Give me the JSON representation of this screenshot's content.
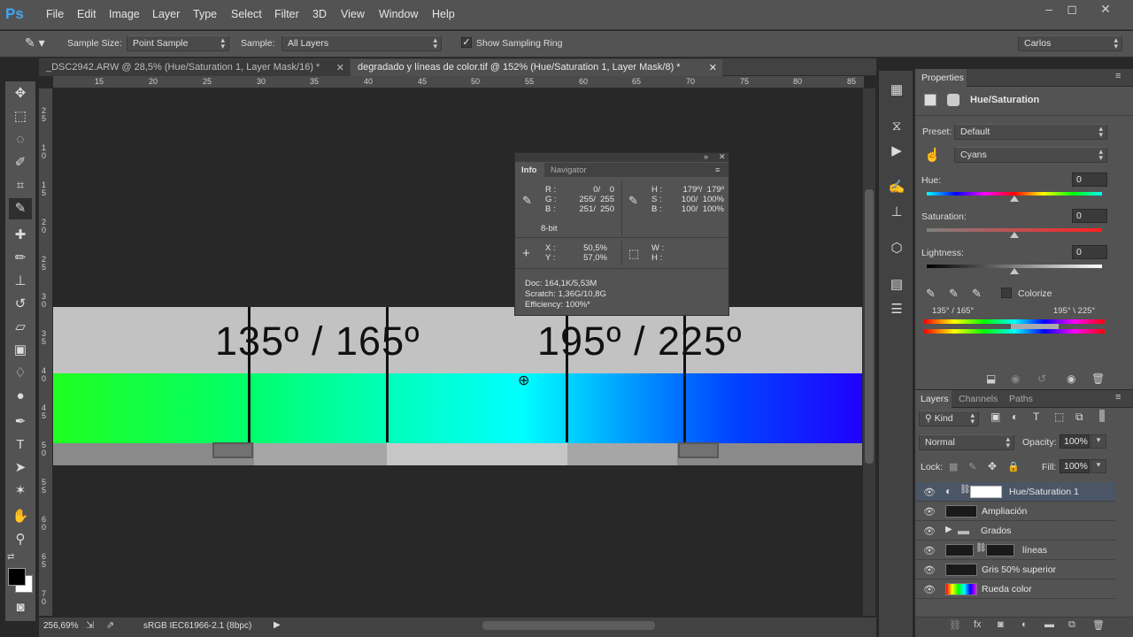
{
  "app": {
    "logo": "Ps"
  },
  "menu": [
    "File",
    "Edit",
    "Image",
    "Layer",
    "Type",
    "Select",
    "Filter",
    "3D",
    "View",
    "Window",
    "Help"
  ],
  "window_controls": {
    "minimize": "–",
    "maximize": "◻",
    "close": "✕"
  },
  "options_bar": {
    "sample_size_label": "Sample Size:",
    "sample_size_value": "Point Sample",
    "sample_label": "Sample:",
    "sample_value": "All Layers",
    "show_ring_label": "Show Sampling Ring",
    "show_ring_checked": true,
    "workspace": "Carlos"
  },
  "tabs": [
    {
      "title": "_DSC2942.ARW @ 28,5% (Hue/Saturation 1, Layer Mask/16) *",
      "close": "✕",
      "active": false
    },
    {
      "title": "degradado y líneas de color.tif @ 152% (Hue/Saturation 1, Layer Mask/8) *",
      "close": "✕",
      "active": true
    }
  ],
  "ruler_top": [
    "15",
    "20",
    "25",
    "30",
    "35",
    "40",
    "45",
    "50",
    "55",
    "60",
    "65",
    "70",
    "75",
    "80",
    "85"
  ],
  "ruler_left": [
    "2",
    "5",
    "1",
    "0",
    "1",
    "5",
    "2",
    "0",
    "2",
    "5",
    "3",
    "0",
    "3",
    "5",
    "4",
    "0",
    "4",
    "5",
    "5",
    "0",
    "5",
    "5",
    "6",
    "0",
    "6",
    "5",
    "7",
    "0"
  ],
  "canvas": {
    "labels": [
      "135º / 165º",
      "195º / 225º"
    ]
  },
  "info_panel": {
    "tabs": [
      "Info",
      "Navigator"
    ],
    "rgb": {
      "R": "0/    0",
      "G": "255/  255",
      "B": "251/  250"
    },
    "hsb": {
      "H": "179º/  179º",
      "S": "100/  100%",
      "B": "100/  100%"
    },
    "bit_depth": "8-bit",
    "xy": {
      "X": "50,5%",
      "Y": "57,0%"
    },
    "wh": {
      "W": "",
      "H": ""
    },
    "doc": "Doc: 164,1K/5,53M",
    "scratch": "Scratch: 1,36G/10,8G",
    "efficiency": "Efficiency: 100%*"
  },
  "status_bar": {
    "zoom": "256,69%",
    "profile": "sRGB IEC61966-2.1 (8bpc)"
  },
  "properties": {
    "tab": "Properties",
    "title": "Hue/Saturation",
    "preset_label": "Preset:",
    "preset_value": "Default",
    "channel_value": "Cyans",
    "hue_label": "Hue:",
    "hue_value": "0",
    "saturation_label": "Saturation:",
    "saturation_value": "0",
    "lightness_label": "Lightness:",
    "lightness_value": "0",
    "colorize_label": "Colorize",
    "range_left": "135° / 165°",
    "range_right": "195° \\ 225°"
  },
  "layers_panel": {
    "tabs": [
      "Layers",
      "Channels",
      "Paths"
    ],
    "kind_label": "Kind",
    "blend_mode": "Normal",
    "opacity_label": "Opacity:",
    "opacity_value": "100%",
    "lock_label": "Lock:",
    "fill_label": "Fill:",
    "fill_value": "100%",
    "layers": [
      {
        "name": "Hue/Saturation 1",
        "selected": true
      },
      {
        "name": "Ampliación",
        "selected": false
      },
      {
        "name": "Grados",
        "selected": false
      },
      {
        "name": "líneas",
        "selected": false
      },
      {
        "name": "Gris 50% superior",
        "selected": false
      },
      {
        "name": "Rueda color",
        "selected": false
      }
    ]
  },
  "colors": {
    "accent": "#3fa8f5",
    "panel": "#535353",
    "canvas_bg": "#282828"
  }
}
